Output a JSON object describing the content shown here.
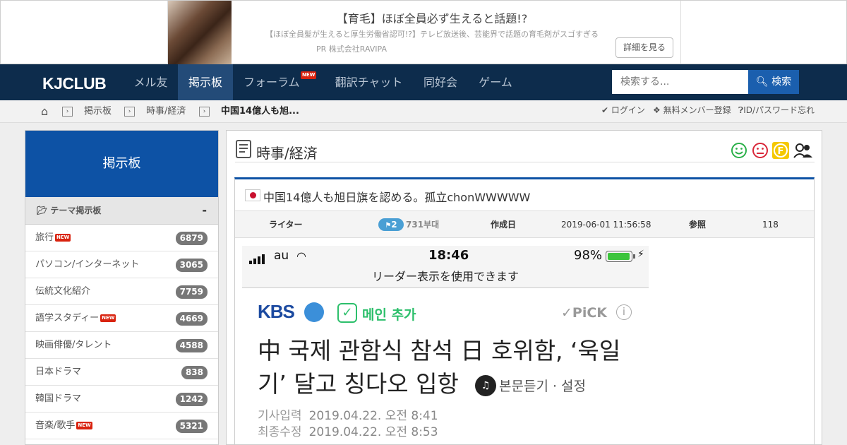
{
  "ad": {
    "title": "【育毛】ほぼ全員必ず生えると話題!?",
    "description": "【ほぼ全員髪が生えると厚生労働省認可!?】テレビ放送後、芸能界で話題の育毛剤がスゴすぎる",
    "sponsor": "PR 株式会社RAVIPA",
    "button_label": "詳細を見る"
  },
  "nav": {
    "logo": "KJCLUB",
    "items": [
      {
        "label": "メル友"
      },
      {
        "label": "掲示板"
      },
      {
        "label": "フォーラム"
      },
      {
        "label": "翻訳チャット"
      },
      {
        "label": "同好会"
      },
      {
        "label": "ゲーム"
      }
    ],
    "active_index": 1,
    "new_badge": "NEW",
    "search_placeholder": "検索する...",
    "search_button": "検索"
  },
  "breadcrumb": {
    "items": [
      "掲示板",
      "時事/経済",
      "中国14億人も旭..."
    ],
    "sep": "›"
  },
  "account": {
    "login": "ログイン",
    "register": "無料メンバー登録",
    "forgot": "ID/パスワード忘れ"
  },
  "sidebar": {
    "title": "掲示板",
    "section": "テーマ掲示板",
    "collapse": "-",
    "items": [
      {
        "label": "旅行",
        "count": "6879",
        "new": true
      },
      {
        "label": "パソコン/インターネット",
        "count": "3065",
        "new": false
      },
      {
        "label": "伝統文化紹介",
        "count": "7759",
        "new": false
      },
      {
        "label": "語学スタディー",
        "count": "4669",
        "new": true
      },
      {
        "label": "映画俳優/タレント",
        "count": "4588",
        "new": false
      },
      {
        "label": "日本ドラマ",
        "count": "838",
        "new": false
      },
      {
        "label": "韓国ドラマ",
        "count": "1242",
        "new": false
      },
      {
        "label": "音楽/歌手",
        "count": "5321",
        "new": true
      }
    ]
  },
  "board": {
    "title": "時事/経済"
  },
  "post": {
    "title": "中国14億人も旭日旗を認める。孤立chonWWWWW",
    "writer_label": "ライター",
    "level": "2",
    "writer": "731부대",
    "date_label": "作成日",
    "date": "2019-06-01 11:56:58",
    "views_label": "参照",
    "views": "118"
  },
  "screenshot": {
    "carrier": "au",
    "time": "18:46",
    "battery": "98%",
    "battery_level": 0.98,
    "reader_text": "リーダー表示を使用できます",
    "kbs": "KBS",
    "main_add": "메인 추가",
    "pick": "✓PiCK",
    "headline": "中 국제 관함식 참석 日 호위함, ‘욱일기’ 달고 칭다오 입항",
    "listen": "본문듣기 · 설정",
    "input_label": "기사입력",
    "input_date": "2019.04.22. 오전 8:41",
    "edit_label": "최종수정",
    "edit_date": "2019.04.22. 오전 8:53"
  }
}
